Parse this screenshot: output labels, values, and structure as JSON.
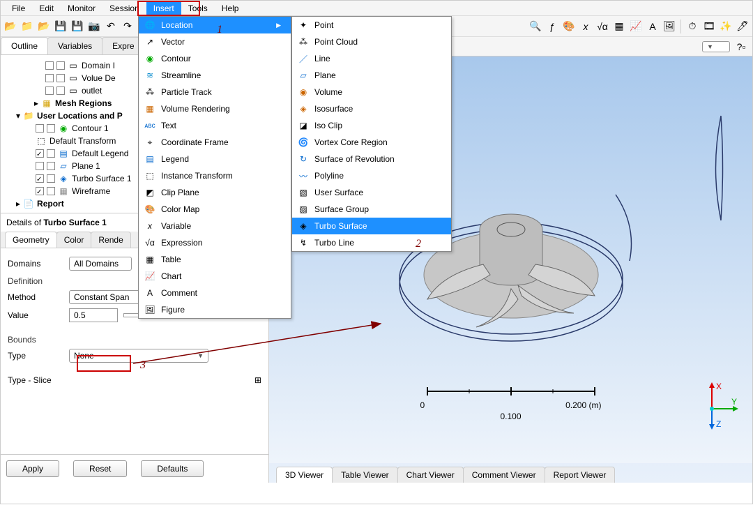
{
  "menu": {
    "file": "File",
    "edit": "Edit",
    "monitor": "Monitor",
    "session": "Session",
    "insert": "Insert",
    "tools": "Tools",
    "help": "Help"
  },
  "outline_tabs": {
    "outline": "Outline",
    "variables": "Variables",
    "expr": "Expre"
  },
  "tree": {
    "domain": "Domain I",
    "volume": "Volue De",
    "outlet": "outlet",
    "mesh_regions": "Mesh Regions",
    "user_loc": "User Locations and P",
    "contour1": "Contour 1",
    "def_transform": "Default Transform",
    "def_legend": "Default Legend",
    "plane1": "Plane 1",
    "turbo_surf1": "Turbo Surface 1",
    "wireframe": "Wireframe",
    "report": "Report"
  },
  "details": {
    "title_prefix": "Details of ",
    "title_obj": "Turbo Surface 1",
    "tabs": {
      "geometry": "Geometry",
      "color": "Color",
      "render": "Rende"
    },
    "domains_lbl": "Domains",
    "domains_val": "All Domains",
    "definition_lbl": "Definition",
    "method_lbl": "Method",
    "method_val": "Constant Span",
    "value_lbl": "Value",
    "value_val": "0.5",
    "bounds_lbl": "Bounds",
    "type_lbl": "Type",
    "type_val": "None",
    "typeslice_lbl": "Type - Slice",
    "apply": "Apply",
    "reset": "Reset",
    "defaults": "Defaults"
  },
  "insert_menu": {
    "location": "Location",
    "vector": "Vector",
    "contour": "Contour",
    "streamline": "Streamline",
    "particle": "Particle Track",
    "volrend": "Volume Rendering",
    "text": "Text",
    "coord": "Coordinate Frame",
    "legend": "Legend",
    "instance": "Instance Transform",
    "clip": "Clip Plane",
    "colormap": "Color Map",
    "variable": "Variable",
    "expression": "Expression",
    "table": "Table",
    "chart": "Chart",
    "comment": "Comment",
    "figure": "Figure"
  },
  "location_menu": {
    "point": "Point",
    "pointcloud": "Point Cloud",
    "line": "Line",
    "plane": "Plane",
    "volume": "Volume",
    "isosurf": "Isosurface",
    "isoclip": "Iso Clip",
    "vortex": "Vortex Core Region",
    "revolve": "Surface of Revolution",
    "polyline": "Polyline",
    "usersurf": "User Surface",
    "surfgroup": "Surface Group",
    "turbosurf": "Turbo Surface",
    "turboline": "Turbo Line"
  },
  "viewer_tabs": {
    "v3d": "3D Viewer",
    "table": "Table Viewer",
    "chart": "Chart Viewer",
    "comment": "Comment Viewer",
    "report": "Report Viewer"
  },
  "scale": {
    "left": "0",
    "right": "0.200",
    "unit": "(m)",
    "mid": "0.100"
  },
  "triad": {
    "x": "X",
    "y": "Y",
    "z": "Z"
  },
  "annotations": {
    "a1": "1",
    "a2": "2",
    "a3": "3"
  }
}
